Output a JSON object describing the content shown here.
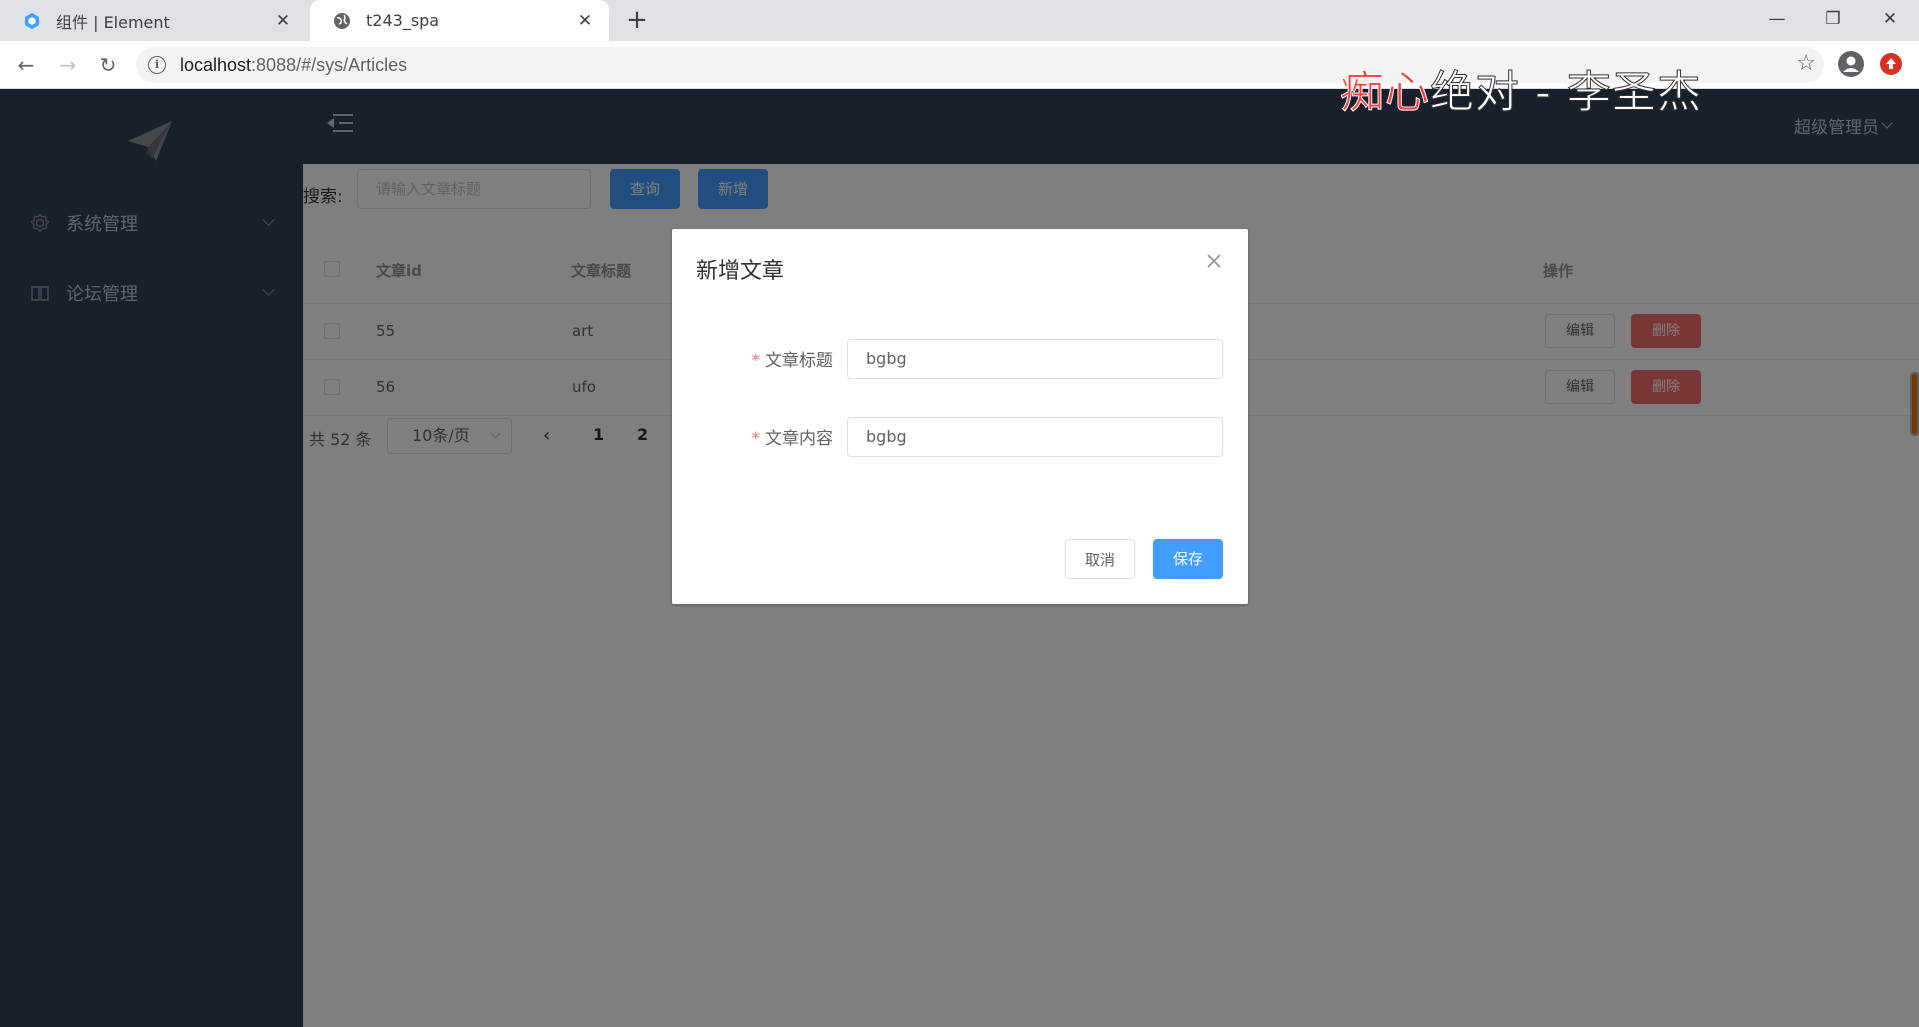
{
  "browser": {
    "tabs": [
      {
        "title": "组件 | Element",
        "active": false
      },
      {
        "title": "t243_spa",
        "active": true
      }
    ],
    "url_host": "localhost",
    "url_rest": ":8088/#/sys/Articles"
  },
  "sidebar": {
    "items": [
      {
        "label": "系统管理",
        "icon": "gear-icon"
      },
      {
        "label": "论坛管理",
        "icon": "book-icon"
      }
    ]
  },
  "navbar": {
    "user": "超级管理员"
  },
  "watermark": {
    "red_part": "痴心",
    "white_part": "绝对 - 李圣杰"
  },
  "toolbar": {
    "search_label": "搜索:",
    "search_placeholder": "请输入文章标题",
    "query_label": "查询",
    "add_label": "新增"
  },
  "table": {
    "headers": {
      "id": "文章id",
      "title": "文章标题",
      "ops": "操作"
    },
    "rows": [
      {
        "id": "55",
        "title": "art",
        "edit": "编辑",
        "delete": "删除"
      },
      {
        "id": "56",
        "title": "ufo",
        "edit": "编辑",
        "delete": "删除"
      }
    ]
  },
  "pagination": {
    "total": "共 52 条",
    "page_size": "10条/页",
    "pages": [
      "1",
      "2"
    ]
  },
  "dialog": {
    "title": "新增文章",
    "fields": [
      {
        "label": "文章标题",
        "value": "bgbg",
        "required": true
      },
      {
        "label": "文章内容",
        "value": "bgbg",
        "required": true
      }
    ],
    "cancel_label": "取消",
    "save_label": "保存"
  },
  "colors": {
    "sidebar_bg": "#304156",
    "primary": "#409eff",
    "danger": "#f56c6c"
  }
}
